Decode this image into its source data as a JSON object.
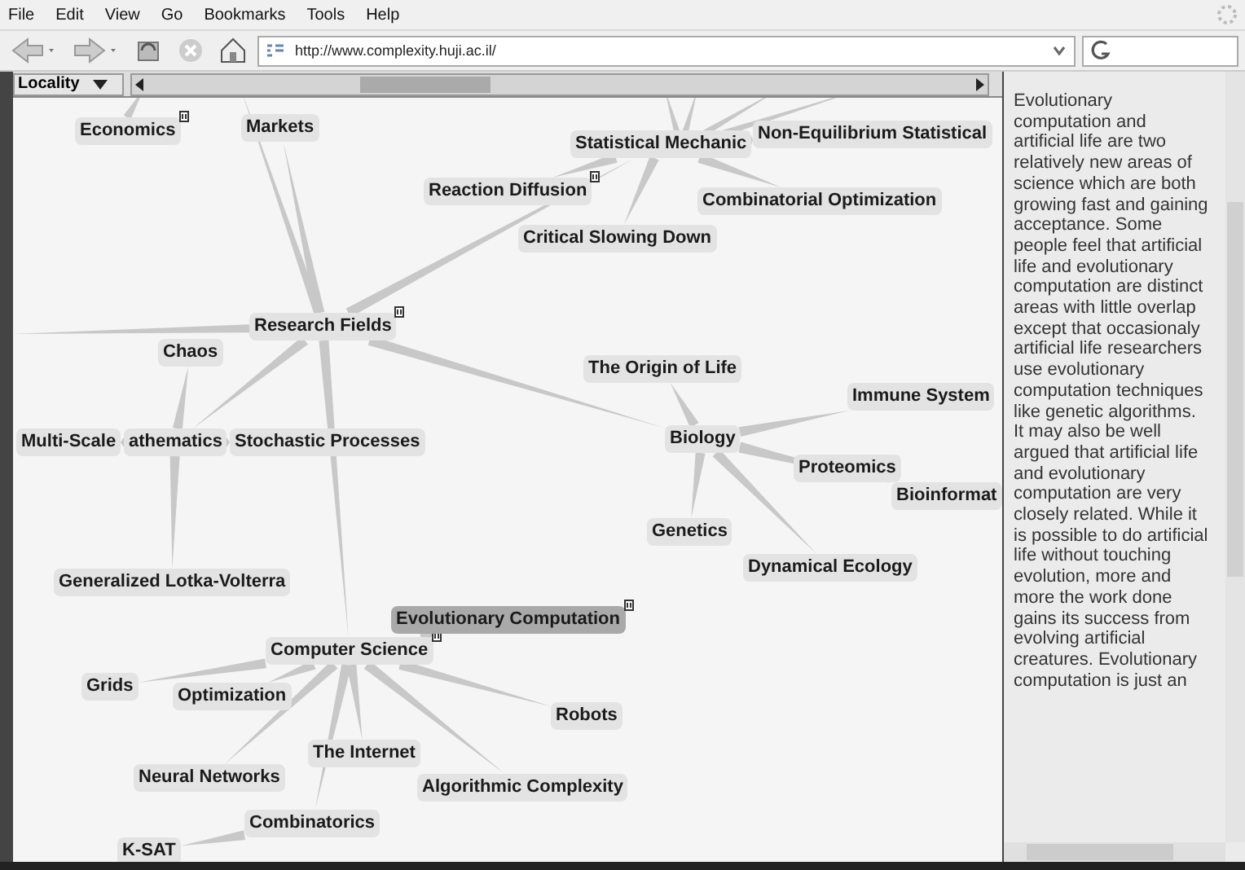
{
  "menu": [
    {
      "label": "File"
    },
    {
      "label": "Edit"
    },
    {
      "label": "View"
    },
    {
      "label": "Go"
    },
    {
      "label": "Bookmarks"
    },
    {
      "label": "Tools"
    },
    {
      "label": "Help"
    }
  ],
  "toolbar": {
    "url": "http://www.complexity.huji.ac.il/"
  },
  "locality": {
    "label": "Locality"
  },
  "graph": {
    "nodes": [
      {
        "label": "Economics",
        "expandable": true,
        "selected": false
      },
      {
        "label": "Research Fields",
        "expandable": true,
        "selected": false,
        "children": [
          {
            "label": "Markets",
            "expandable": false,
            "selected": false
          },
          {
            "label": "Statistical Mechanic",
            "expandable": false,
            "selected": false,
            "children": [
              {
                "label": "Non-Equilibrium Statistical",
                "expandable": false,
                "selected": false
              },
              {
                "label": "Reaction Diffusion",
                "expandable": true,
                "selected": false
              },
              {
                "label": "Combinatorial Optimization",
                "expandable": false,
                "selected": false
              },
              {
                "label": "Critical Slowing Down",
                "expandable": false,
                "selected": false
              }
            ]
          },
          {
            "label": "athematics",
            "expandable": false,
            "selected": false,
            "children": [
              {
                "label": "Chaos",
                "expandable": false,
                "selected": false
              },
              {
                "label": "Multi-Scale",
                "expandable": false,
                "selected": false
              },
              {
                "label": "Stochastic Processes",
                "expandable": false,
                "selected": false
              },
              {
                "label": "Generalized Lotka-Volterra",
                "expandable": false,
                "selected": false
              }
            ]
          },
          {
            "label": "Biology",
            "expandable": false,
            "selected": false,
            "children": [
              {
                "label": "The Origin of Life",
                "expandable": false,
                "selected": false
              },
              {
                "label": "Immune System",
                "expandable": false,
                "selected": false
              },
              {
                "label": "Proteomics",
                "expandable": false,
                "selected": false
              },
              {
                "label": "Bioinformat",
                "expandable": false,
                "selected": false
              },
              {
                "label": "Genetics",
                "expandable": false,
                "selected": false
              },
              {
                "label": "Dynamical Ecology",
                "expandable": false,
                "selected": false
              }
            ]
          },
          {
            "label": "Computer Science",
            "expandable": true,
            "selected": false,
            "children": [
              {
                "label": "Evolutionary Computation",
                "expandable": true,
                "selected": true
              },
              {
                "label": "Grids",
                "expandable": false,
                "selected": false
              },
              {
                "label": "Optimization",
                "expandable": false,
                "selected": false
              },
              {
                "label": "The Internet",
                "expandable": false,
                "selected": false
              },
              {
                "label": "Robots",
                "expandable": false,
                "selected": false
              },
              {
                "label": "Neural Networks",
                "expandable": false,
                "selected": false
              },
              {
                "label": "Algorithmic Complexity",
                "expandable": false,
                "selected": false
              },
              {
                "label": "Combinatorics",
                "expandable": false,
                "selected": false,
                "children": [
                  {
                    "label": "K-SAT",
                    "expandable": false,
                    "selected": false
                  }
                ]
              }
            ]
          }
        ]
      }
    ]
  },
  "article": {
    "text": "Evolutionary computation and artificial life are two relatively new areas of science which are both growing fast and gaining acceptance. Some people feel that artificial life and evolutionary computation are distinct areas with little overlap except that occasionaly artificial life researchers use evolutionary computation techniques like genetic algorithms. It may also be well argued that artificial life and evolutionary computation are very closely related. While it is possible to do artificial life without touching evolution, more and more the work done gains its success from evolving artificial creatures. Evolutionary computation is just an"
  }
}
